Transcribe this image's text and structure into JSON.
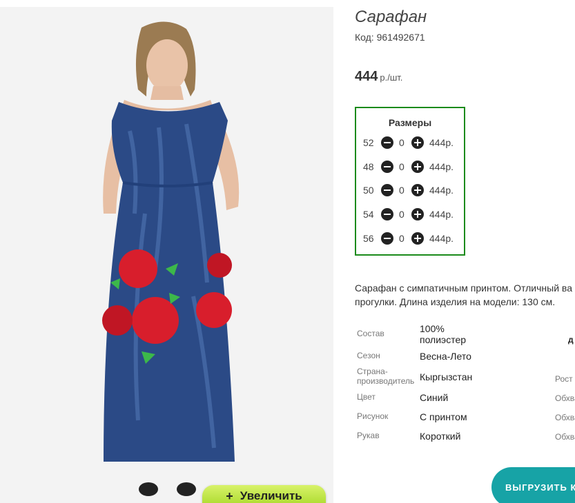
{
  "product": {
    "title": "Сарафан",
    "code": "Код: 961492671",
    "price": "444",
    "price_unit": "р./шт."
  },
  "sizes": {
    "title": "Размеры",
    "rows": [
      {
        "size": "52",
        "qty": "0",
        "price": "444р."
      },
      {
        "size": "48",
        "qty": "0",
        "price": "444р."
      },
      {
        "size": "50",
        "qty": "0",
        "price": "444р."
      },
      {
        "size": "54",
        "qty": "0",
        "price": "444р."
      },
      {
        "size": "56",
        "qty": "0",
        "price": "444р."
      }
    ]
  },
  "description": {
    "line1": "Сарафан с симпатичным принтом. Отличный ва",
    "line2": "прогулки. Длина изделия на модели: 130 см."
  },
  "properties": [
    {
      "label": "Состав",
      "value": "100% полиэстер"
    },
    {
      "label": "Сезон",
      "value": "Весна-Лето"
    },
    {
      "label": "Страна-производитель",
      "value": "Кыргызстан"
    },
    {
      "label": "Цвет",
      "value": "Синий"
    },
    {
      "label": "Рисунок",
      "value": "С принтом"
    },
    {
      "label": "Рукав",
      "value": "Короткий"
    }
  ],
  "right_props": {
    "d": "д",
    "rost": "Рост",
    "obhv1": "Обхва",
    "obhv2": "Обхва",
    "obhv3": "Обхва"
  },
  "buttons": {
    "zoom_icon": "+",
    "zoom_label": "Увеличить",
    "export_label": "ВЫГРУЗИТЬ К"
  },
  "colors": {
    "accent_green": "#1a8a1a",
    "export_teal": "#17a3a6",
    "zoom_lime": "#bfe54a",
    "dress_blue": "#2b4a86",
    "flower_red": "#d81e2c"
  },
  "icons": {
    "minus": "minus-circle-icon",
    "plus": "plus-circle-icon"
  }
}
